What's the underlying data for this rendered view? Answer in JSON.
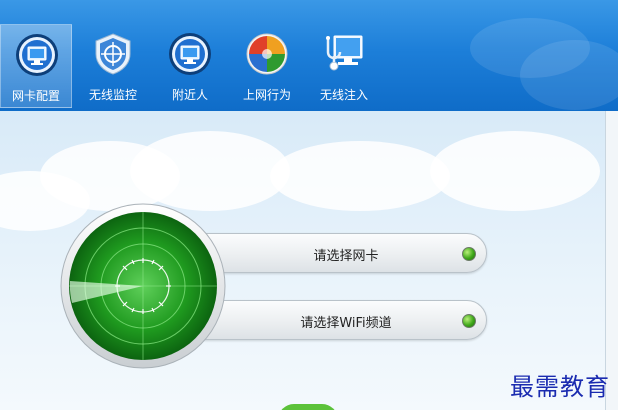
{
  "toolbar": {
    "items": [
      {
        "label": "网卡配置",
        "icon": "monitor-icon",
        "active": true
      },
      {
        "label": "无线监控",
        "icon": "shield-icon",
        "active": false
      },
      {
        "label": "附近人",
        "icon": "monitor-icon",
        "active": false
      },
      {
        "label": "上网行为",
        "icon": "windows-logo-icon",
        "active": false
      },
      {
        "label": "无线注入",
        "icon": "stethoscope-monitor-icon",
        "active": false
      }
    ]
  },
  "main": {
    "select_nic_label": "请选择网卡",
    "select_channel_label": "请选择WiFi频道"
  },
  "watermark": "最需教育",
  "colors": {
    "toolbar_blue": "#1d7fd9",
    "radar_green": "#1f9a1f",
    "status_dot_green": "#3fa81a",
    "watermark_blue": "#1a2bb0"
  }
}
